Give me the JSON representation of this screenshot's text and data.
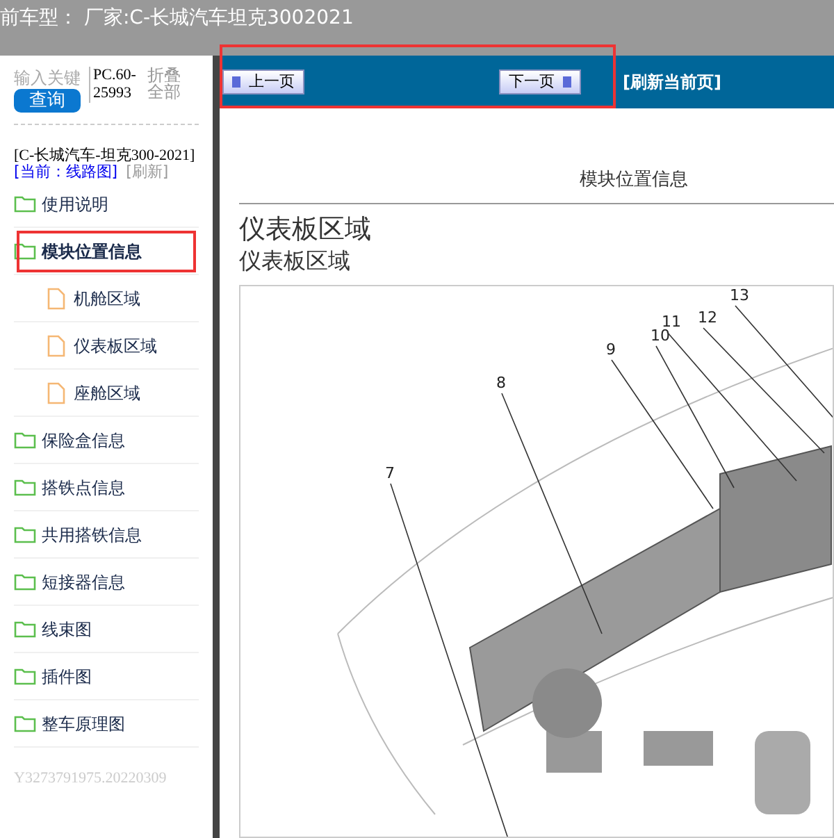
{
  "top_bar": {
    "title": "前车型：  厂家:C-长城汽车坦克3002021"
  },
  "sidebar": {
    "search": {
      "placeholder": "输入关键"
    },
    "search_button": "查询",
    "code": "PC.60-25993",
    "collapse_all": "折叠全部",
    "vehicle": "[C-长城汽车-坦克300-2021]",
    "current": "[当前：线路图]",
    "refresh": "[刷新]",
    "tree": [
      {
        "label": "使用说明",
        "kind": "folder",
        "expanded": false,
        "highlighted": false
      },
      {
        "label": "模块位置信息",
        "kind": "folder",
        "expanded": true,
        "highlighted": true,
        "children": [
          {
            "label": "机舱区域",
            "kind": "page"
          },
          {
            "label": "仪表板区域",
            "kind": "page"
          },
          {
            "label": "座舱区域",
            "kind": "page"
          }
        ]
      },
      {
        "label": "保险盒信息",
        "kind": "folder",
        "expanded": false,
        "highlighted": false
      },
      {
        "label": "搭铁点信息",
        "kind": "folder",
        "expanded": false,
        "highlighted": false
      },
      {
        "label": "共用搭铁信息",
        "kind": "folder",
        "expanded": false,
        "highlighted": false
      },
      {
        "label": "短接器信息",
        "kind": "folder",
        "expanded": false,
        "highlighted": false
      },
      {
        "label": "线束图",
        "kind": "folder",
        "expanded": false,
        "highlighted": false
      },
      {
        "label": "插件图",
        "kind": "folder",
        "expanded": false,
        "highlighted": false
      },
      {
        "label": "整车原理图",
        "kind": "folder",
        "expanded": false,
        "highlighted": false
      }
    ],
    "footer": "Y3273791975.20220309"
  },
  "toolbar": {
    "prev": "上一页",
    "next": "下一页",
    "refresh": "[刷新当前页]",
    "highlighted": true
  },
  "content": {
    "section": "模块位置信息",
    "title": "仪表板区域",
    "subtitle": "仪表板区域",
    "callouts": [
      "7",
      "8",
      "9",
      "10",
      "11",
      "12",
      "13"
    ]
  }
}
